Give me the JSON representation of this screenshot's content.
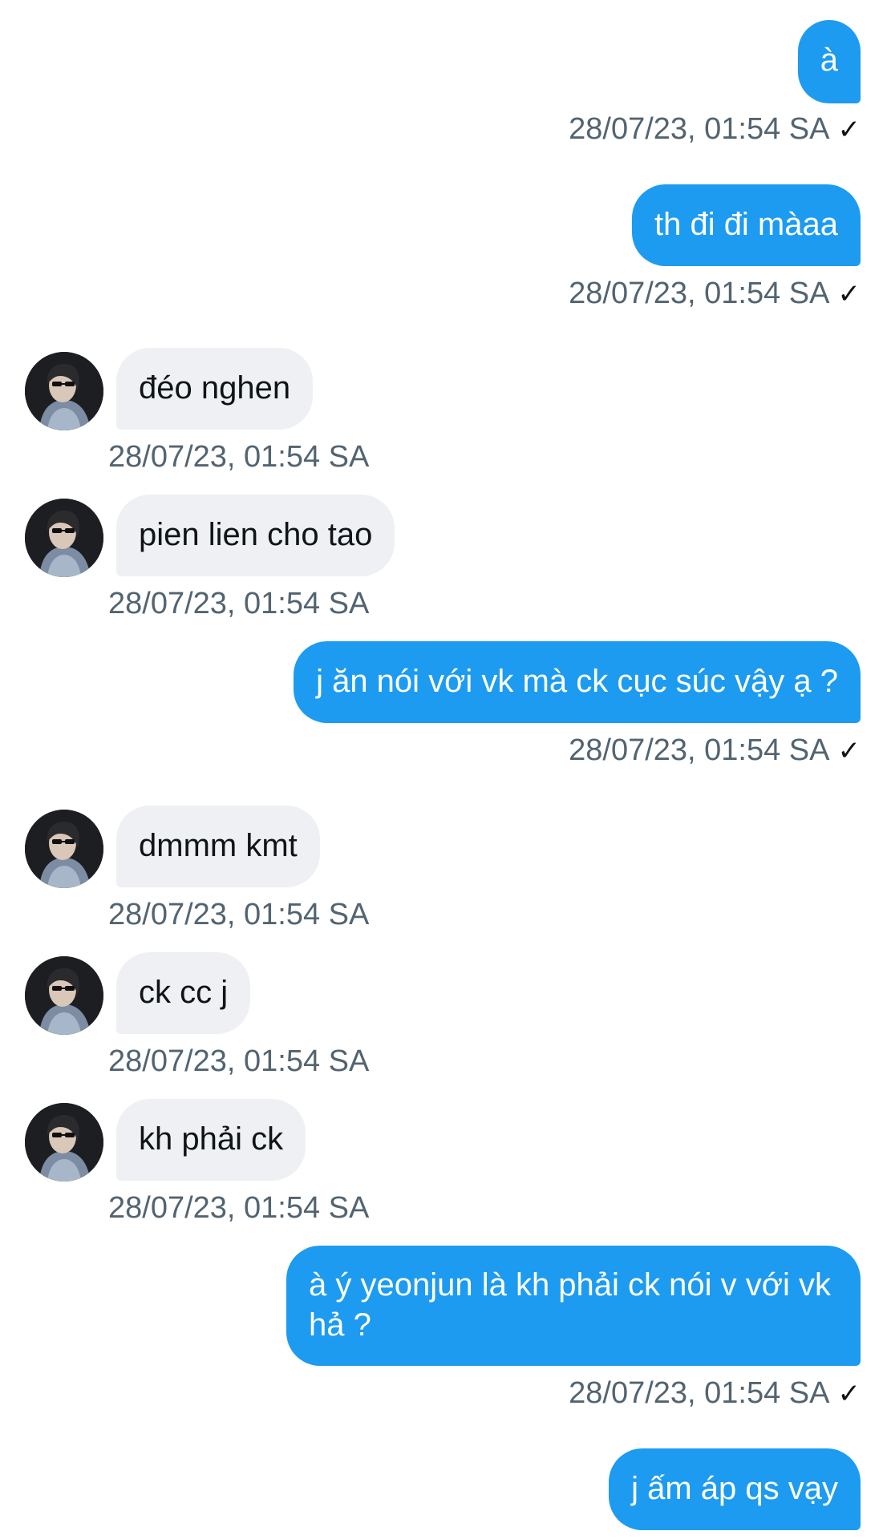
{
  "conversation": {
    "messages": [
      {
        "side": "out",
        "text": "à",
        "time": "28/07/23, 01:54 SA"
      },
      {
        "side": "out",
        "text": "th đi đi màaa",
        "time": "28/07/23, 01:54 SA"
      },
      {
        "side": "in",
        "text": "đéo nghen",
        "time": "28/07/23, 01:54 SA"
      },
      {
        "side": "in",
        "text": "pien lien cho tao",
        "time": "28/07/23, 01:54 SA"
      },
      {
        "side": "out",
        "text": "j ăn nói với vk mà ck cục súc vậy ạ ?",
        "time": "28/07/23, 01:54 SA"
      },
      {
        "side": "in",
        "text": "dmmm kmt",
        "time": "28/07/23, 01:54 SA"
      },
      {
        "side": "in",
        "text": "ck cc j",
        "time": "28/07/23, 01:54 SA"
      },
      {
        "side": "in",
        "text": "kh phải ck",
        "time": "28/07/23, 01:54 SA"
      },
      {
        "side": "out",
        "text": "à ý yeonjun là kh phải ck nói v với vk hả ?",
        "time": "28/07/23, 01:54 SA"
      },
      {
        "side": "out",
        "text": "j ấm áp qs vạy",
        "time": ""
      }
    ],
    "read_mark": "✓",
    "colors": {
      "outgoing_bubble": "#1d9bf0",
      "incoming_bubble": "#eef0f3",
      "timestamp": "#536471"
    },
    "icons": {
      "avatar": "contact-avatar",
      "read_receipt": "checkmark-icon"
    }
  }
}
